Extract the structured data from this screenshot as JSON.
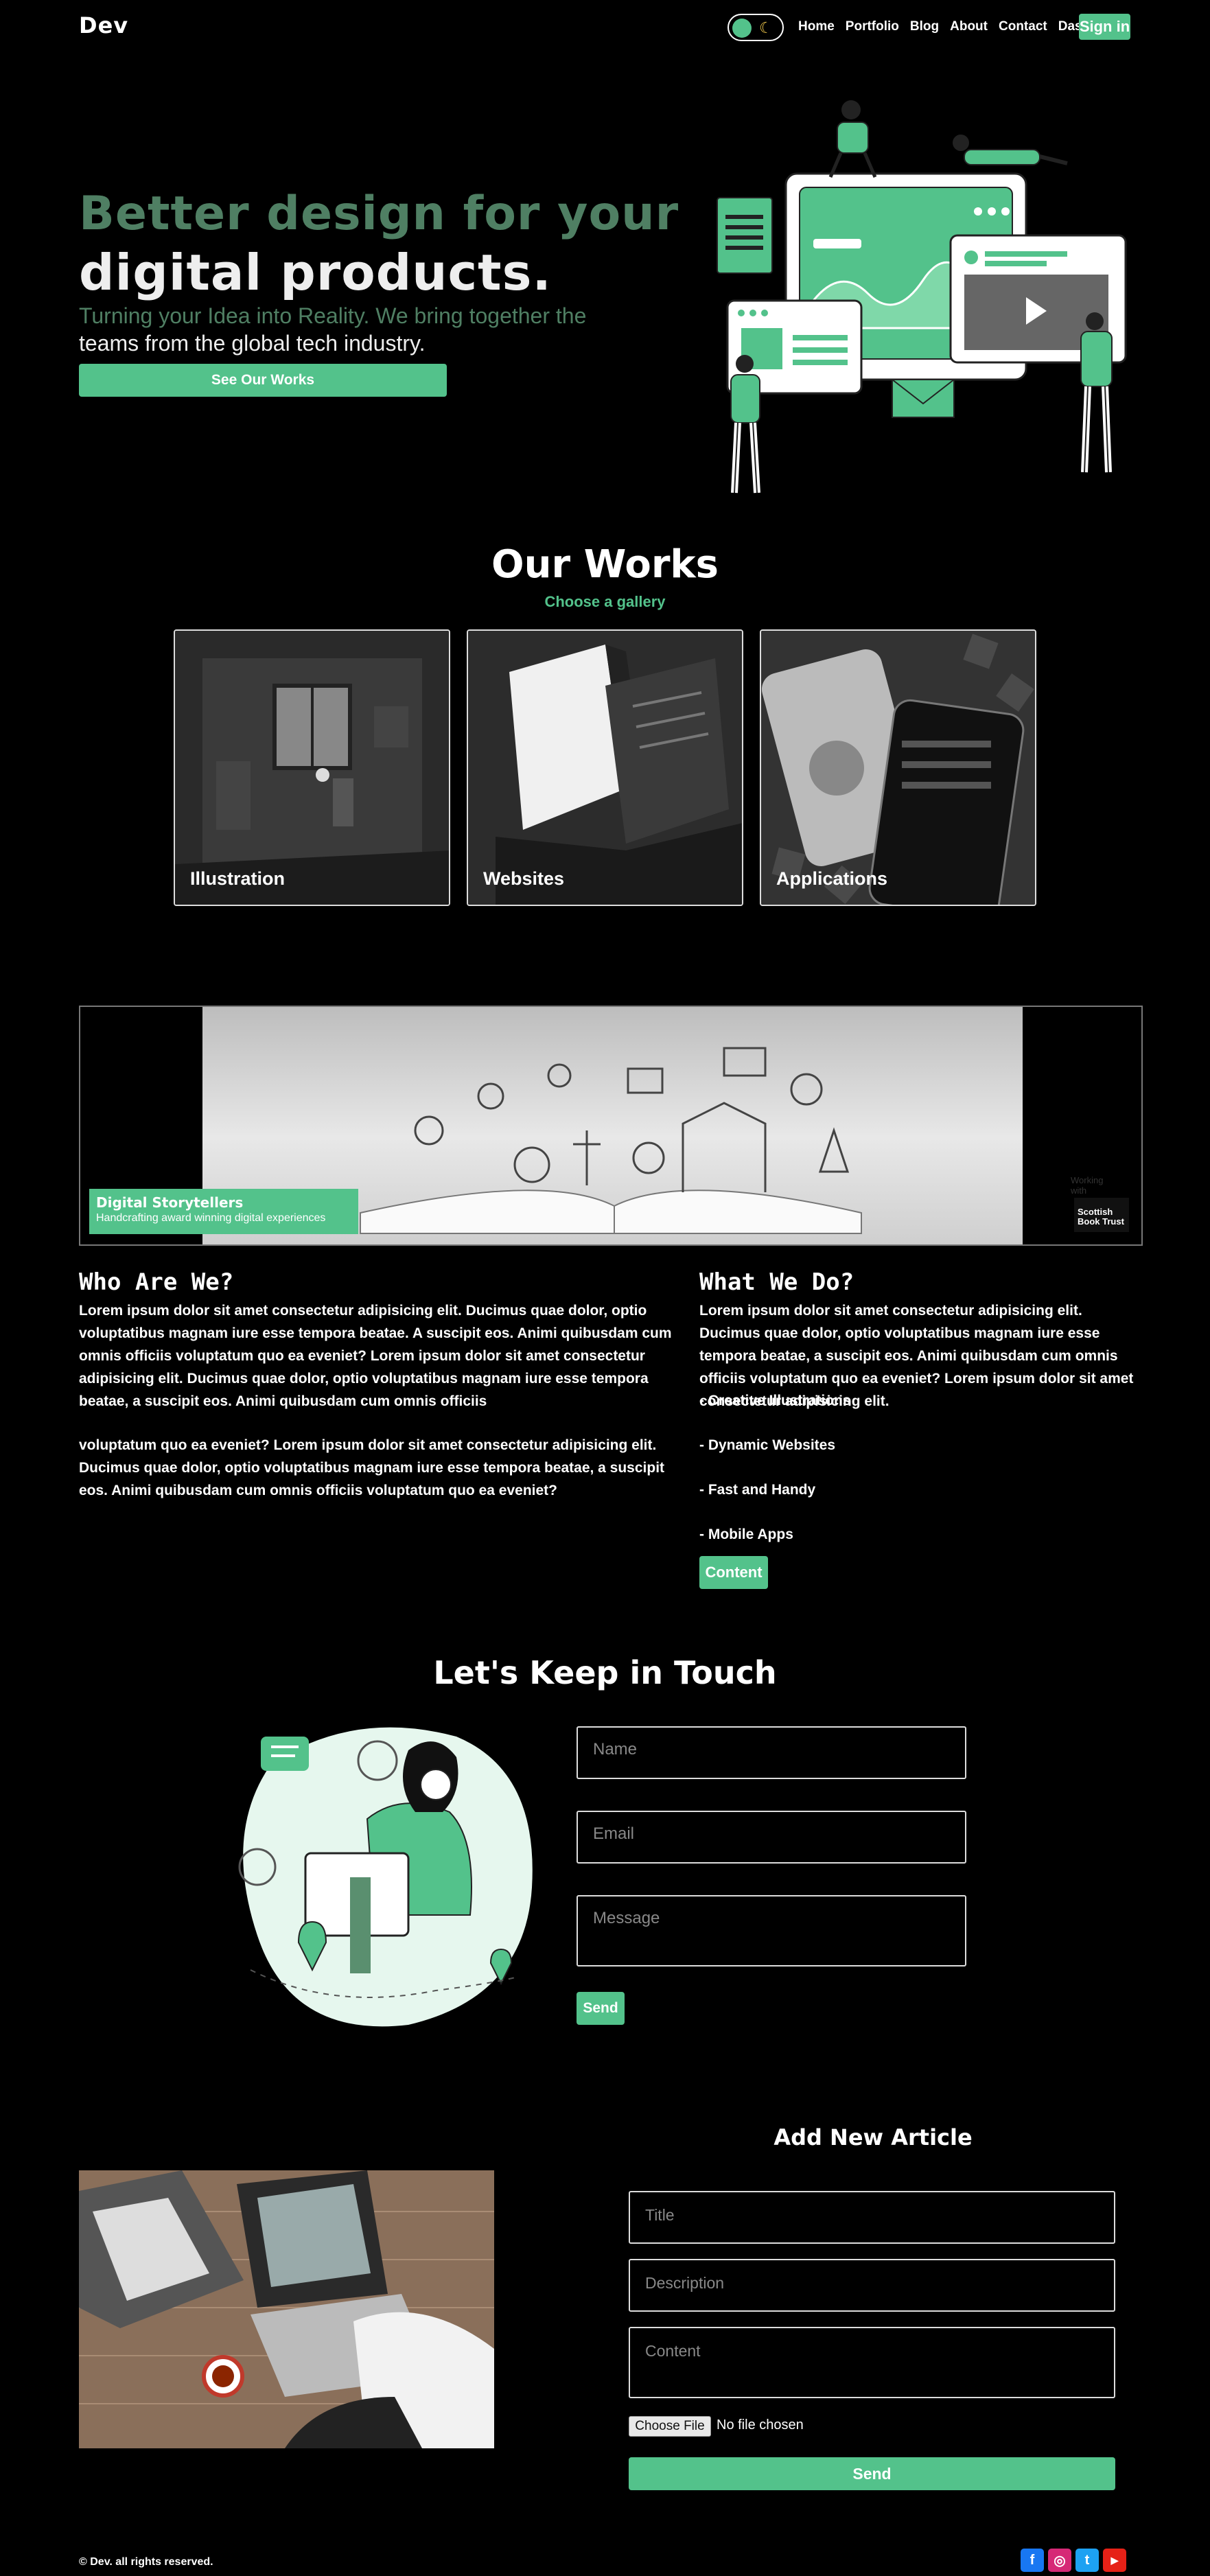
{
  "brand": {
    "logo": "Dev"
  },
  "theme_toggle": {
    "moon": "☾"
  },
  "nav": {
    "links": [
      "Home",
      "Portfolio",
      "Blog",
      "About",
      "Contact",
      "Dashboard"
    ],
    "signin": "Sign in"
  },
  "hero": {
    "line1": "Better design for your",
    "line2": "digital products.",
    "sub1": "Turning your Idea into Reality. We bring together the",
    "sub2": "teams from the global tech industry.",
    "button": "See Our Works"
  },
  "works": {
    "title": "Our Works",
    "subtitle": "Choose a gallery",
    "cards": [
      {
        "label": "Illustration"
      },
      {
        "label": "Websites"
      },
      {
        "label": "Applications"
      }
    ]
  },
  "banner": {
    "title": "Digital Storytellers",
    "subtitle": "Handcrafting award winning digital experiences",
    "working_with": "Working with",
    "partner": "Scottish Book Trust"
  },
  "who": {
    "title": "Who Are We?",
    "p1": "Lorem ipsum dolor sit amet consectetur adipisicing elit. Ducimus quae dolor, optio voluptatibus magnam iure esse tempora beatae. A suscipit eos. Animi quibusdam cum omnis officiis voluptatum quo ea eveniet? Lorem ipsum dolor sit amet consectetur adipisicing elit. Ducimus quae dolor, optio voluptatibus magnam iure esse tempora beatae, a suscipit eos. Animi quibusdam cum omnis officiis",
    "p2": "voluptatum quo ea eveniet? Lorem ipsum dolor sit amet consectetur adipisicing elit. Ducimus quae dolor, optio voluptatibus magnam iure esse tempora beatae, a suscipit eos. Animi quibusdam cum omnis officiis voluptatum quo ea eveniet?"
  },
  "what": {
    "title": "What We Do?",
    "p1": "Lorem ipsum dolor sit amet consectetur adipisicing elit. Ducimus quae dolor, optio voluptatibus magnam iure esse tempora beatae, a suscipit eos. Animi quibusdam cum omnis officiis voluptatum quo ea eveniet? Lorem ipsum dolor sit amet consectetur adipisicing elit.",
    "items": [
      "- Creative Illustrations",
      "- Dynamic Websites",
      "- Fast and Handy",
      "- Mobile Apps"
    ],
    "button": "Content"
  },
  "contact": {
    "title": "Let's Keep in Touch",
    "name_placeholder": "Name",
    "email_placeholder": "Email",
    "message_placeholder": "Message",
    "send": "Send"
  },
  "article": {
    "title": "Add New Article",
    "title_placeholder": "Title",
    "description_placeholder": "Description",
    "content_placeholder": "Content",
    "file_button": "Choose File",
    "file_status": "No file chosen",
    "send": "Send"
  },
  "footer": {
    "copyright": "© Dev. all rights reserved.",
    "socials": [
      {
        "icon": "facebook-icon",
        "glyph": "f",
        "color": "#1877f2"
      },
      {
        "icon": "instagram-icon",
        "glyph": "◎",
        "color": "#d62976"
      },
      {
        "icon": "twitter-icon",
        "glyph": "t",
        "color": "#1da1f2"
      },
      {
        "icon": "youtube-icon",
        "glyph": "▶",
        "color": "#e62117"
      }
    ]
  },
  "colors": {
    "accent": "#53c28b",
    "muted_green": "#4f7f63",
    "background": "#000000"
  }
}
